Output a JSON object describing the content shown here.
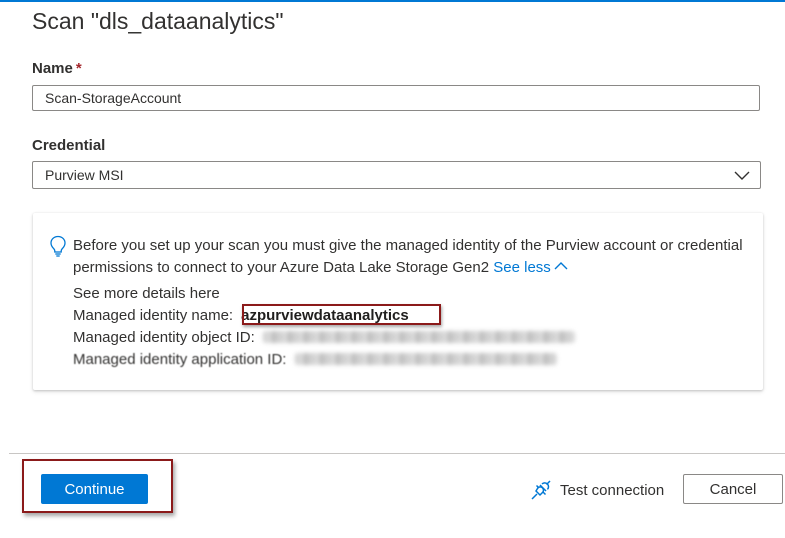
{
  "panel": {
    "title": "Scan \"dls_dataanalytics\""
  },
  "name_field": {
    "label": "Name",
    "required_marker": "*",
    "value": "Scan-StorageAccount"
  },
  "credential_field": {
    "label": "Credential",
    "selected": "Purview MSI",
    "icon": "chevron-down-icon"
  },
  "info_card": {
    "icon": "lightbulb-icon",
    "message": "Before you set up your scan you must give the managed identity of the Purview account or credential permissions to connect to your Azure Data Lake Storage Gen2",
    "see_less_label": "See less",
    "see_more_details_label": "See more details here",
    "mi_name_label": "Managed identity name:",
    "mi_name_value": "azpurviewdataanalytics",
    "mi_object_id_label": "Managed identity object ID:",
    "mi_app_id_label": "Managed identity application ID:"
  },
  "footer": {
    "continue_label": "Continue",
    "test_connection_label": "Test connection",
    "test_connection_icon": "plug-icon",
    "cancel_label": "Cancel"
  },
  "colors": {
    "accent": "#0078d4",
    "required": "#a4262c",
    "highlight_box": "#8b1a1a"
  }
}
